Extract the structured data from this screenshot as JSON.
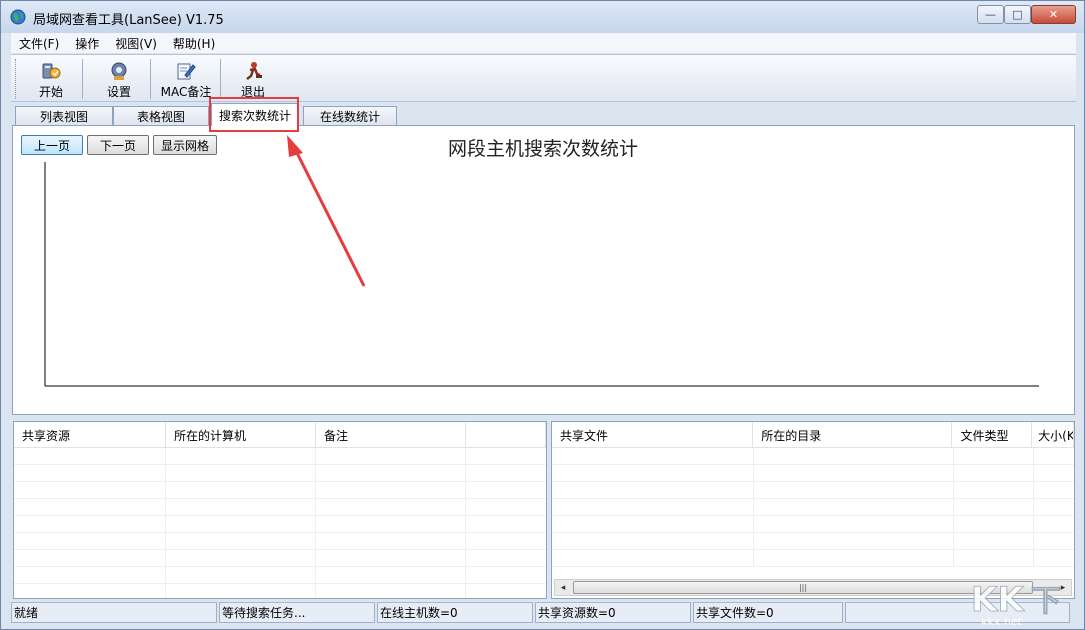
{
  "window": {
    "title": "局域网查看工具(LanSee) V1.75",
    "controls": {
      "minimize": "—",
      "maximize": "□",
      "close": "✕"
    }
  },
  "menu": [
    "文件(F)",
    "操作",
    "视图(V)",
    "帮助(H)"
  ],
  "toolbar": {
    "start": "开始",
    "settings": "设置",
    "mac_note": "MAC备注",
    "exit": "退出"
  },
  "tabs": [
    "列表视图",
    "表格视图",
    "搜索次数统计",
    "在线数统计"
  ],
  "active_tab": "搜索次数统计",
  "chart": {
    "prev_page": "上一页",
    "next_page": "下一页",
    "show_grid": "显示网格",
    "title": "网段主机搜索次数统计"
  },
  "chart_data": {
    "type": "bar",
    "title": "网段主机搜索次数统计",
    "categories": [],
    "values": [],
    "grid": false
  },
  "shares_table": {
    "columns": [
      "共享资源",
      "所在的计算机",
      "备注",
      ""
    ]
  },
  "files_table": {
    "columns": [
      "共享文件",
      "所在的目录",
      "文件类型",
      "大小(K"
    ]
  },
  "scrollbar": {
    "left_arrow": "◂",
    "right_arrow": "▸",
    "grip": "|||"
  },
  "status": {
    "ready": "就绪",
    "waiting": "等待搜索任务...",
    "online_hosts": "在线主机数=0",
    "shared_resources": "共享资源数=0",
    "shared_files": "共享文件数=0"
  },
  "annotation_color": "#e33d3d"
}
